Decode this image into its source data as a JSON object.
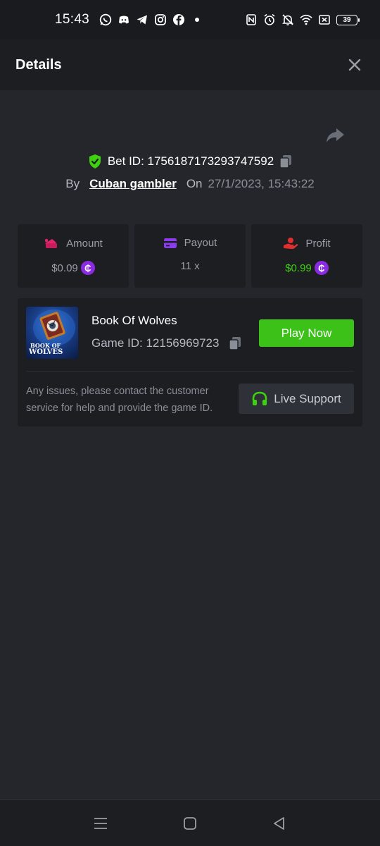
{
  "status_bar": {
    "time": "15:43",
    "battery": "39",
    "icons": [
      "whatsapp-icon",
      "discord-icon",
      "telegram-icon",
      "instagram-icon",
      "facebook-icon",
      "dot-icon",
      "nfc-icon",
      "alarm-icon",
      "mute-icon",
      "wifi-icon",
      "sim-icon",
      "battery-icon"
    ]
  },
  "header": {
    "title": "Details",
    "close_icon": "close-icon"
  },
  "bet": {
    "id_label": "Bet ID: 1756187173293747592",
    "by_label": "By",
    "user": "Cuban gambler",
    "on_label": "On",
    "date": "27/1/2023, 15:43:22"
  },
  "stats": [
    {
      "label": "Amount",
      "value": "$0.09",
      "icon": "amount-icon",
      "has_coin": true,
      "color": "#9a9ea7"
    },
    {
      "label": "Payout",
      "value": "11 x",
      "icon": "card-icon",
      "has_coin": false,
      "color": "#9a9ea7"
    },
    {
      "label": "Profit",
      "value": "$0.99",
      "icon": "profit-icon",
      "has_coin": true,
      "color": "#3ed10f"
    }
  ],
  "coin_symbol": "₵",
  "game": {
    "name": "Book Of Wolves",
    "id_label": "Game ID: 12156969723",
    "play_label": "Play Now",
    "thumb_title_1": "BOOK OF",
    "thumb_title_2": "WOLVES"
  },
  "support": {
    "text": "Any issues, please contact the customer service for help and provide the game ID.",
    "button_label": "Live Support"
  },
  "colors": {
    "accent_green": "#3bc117",
    "profit_green": "#3ed10f",
    "coin_purple": "#8a2be2",
    "background": "#24262b",
    "card": "#1c1e22"
  }
}
